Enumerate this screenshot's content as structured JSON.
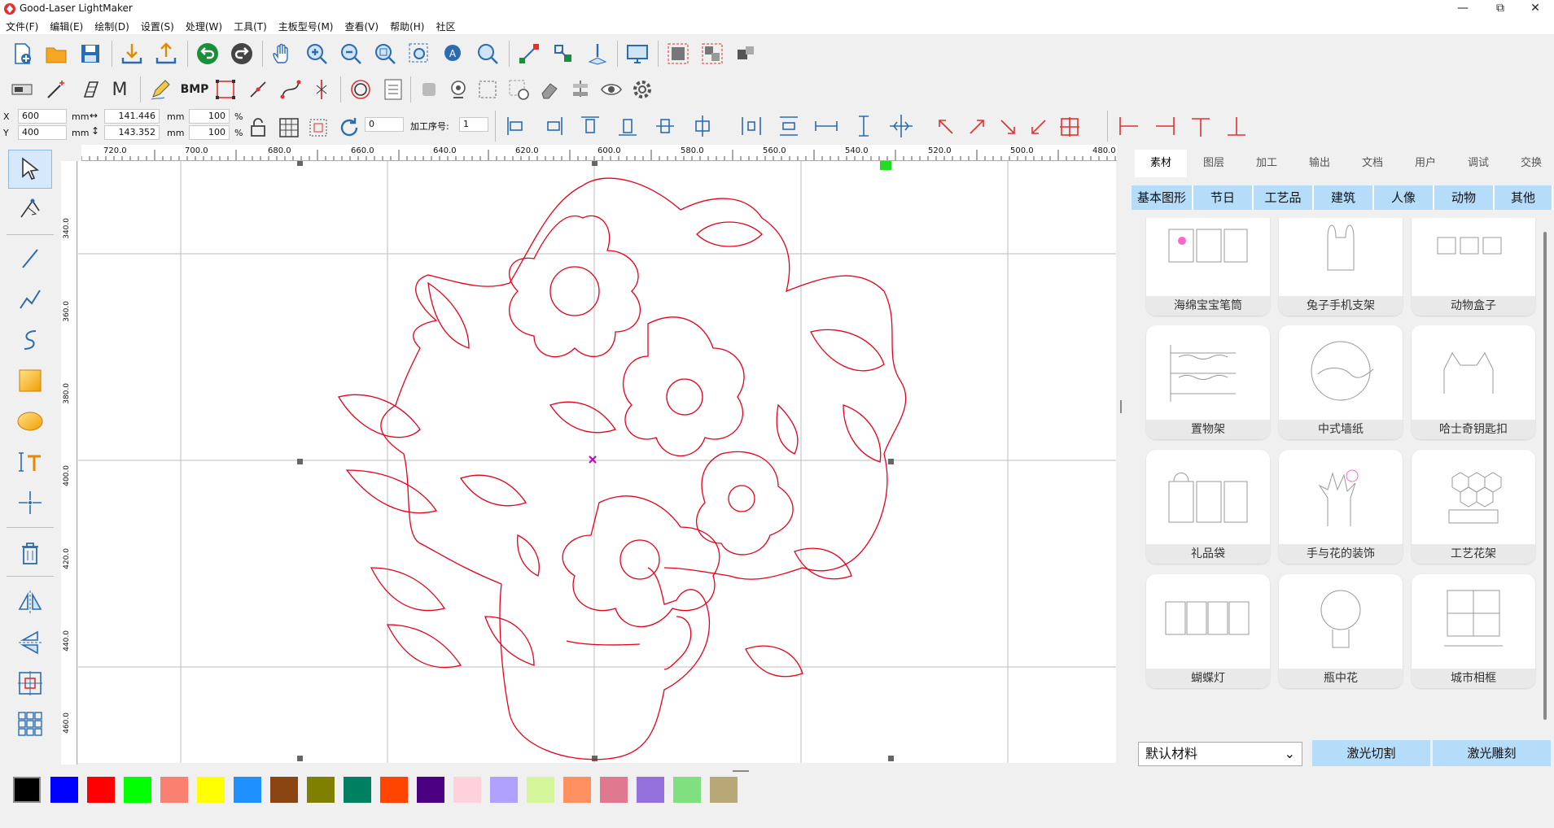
{
  "app": {
    "title": "Good-Laser LightMaker"
  },
  "window_controls": {
    "minimize": "—",
    "restore": "⧉",
    "close": "✕"
  },
  "menu": [
    "文件(F)",
    "编辑(E)",
    "绘制(D)",
    "设置(S)",
    "处理(W)",
    "工具(T)",
    "主板型号(M)",
    "查看(V)",
    "帮助(H)",
    "社区"
  ],
  "toolbar2": {
    "bmp_label": "BMP",
    "m_label": "M"
  },
  "props": {
    "x_label": "X",
    "x_value": "600",
    "x_unit": "mm",
    "y_label": "Y",
    "y_value": "400",
    "y_unit": "mm",
    "width_value": "141.446",
    "width_unit": "mm",
    "height_value": "143.352",
    "height_unit": "mm",
    "scale_x": "100",
    "scale_y": "100",
    "percent": "%",
    "rotate_value": "0",
    "order_label": "加工序号:",
    "order_value": "1"
  },
  "ruler": {
    "h_ticks": [
      "720.0",
      "700.0",
      "680.0",
      "660.0",
      "640.0",
      "620.0",
      "600.0",
      "580.0",
      "560.0",
      "540.0",
      "520.0",
      "500.0",
      "480.0"
    ],
    "v_ticks": [
      "340.0",
      "360.0",
      "380.0",
      "400.0",
      "420.0",
      "440.0",
      "460.0"
    ]
  },
  "right_panel": {
    "tabs": [
      "素材",
      "图层",
      "加工",
      "输出",
      "文档",
      "用户",
      "调试",
      "交换"
    ],
    "active_tab": "素材",
    "categories": [
      "基本图形",
      "节日",
      "工艺品",
      "建筑",
      "人像",
      "动物",
      "其他"
    ],
    "items": [
      "海绵宝宝笔筒",
      "兔子手机支架",
      "动物盒子",
      "置物架",
      "中式墙纸",
      "哈士奇钥匙扣",
      "礼品袋",
      "手与花的装饰",
      "工艺花架",
      "蝴蝶灯",
      "瓶中花",
      "城市相框"
    ],
    "material_select": "默认材料",
    "cut_button": "激光切割",
    "engrave_button": "激光雕刻"
  },
  "palette": [
    "#000000",
    "#0000ff",
    "#ff0000",
    "#00ff00",
    "#fa8072",
    "#ffff00",
    "#1e90ff",
    "#8b4513",
    "#808000",
    "#008060",
    "#ff4500",
    "#4b0082",
    "#ffd1dc",
    "#b0a0ff",
    "#d4f59a",
    "#ff9060",
    "#e07890",
    "#9370db",
    "#80e080",
    "#b8a878"
  ],
  "colors": {
    "drawing": "#e8001c",
    "accent_tab": "#b5dcf9"
  }
}
